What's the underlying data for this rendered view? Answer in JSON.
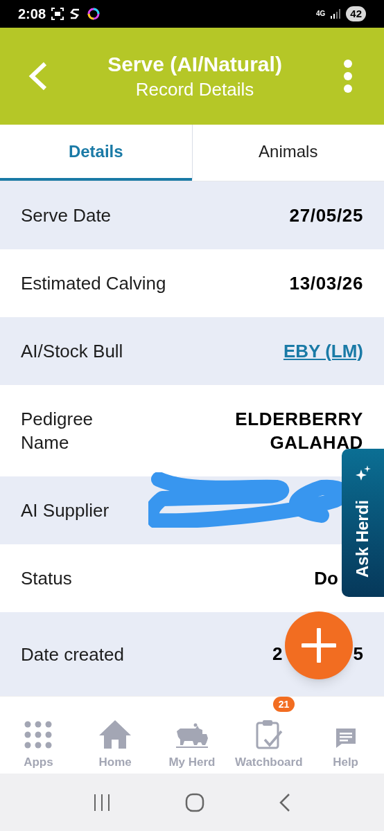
{
  "status_bar": {
    "time": "2:08",
    "network": "4G",
    "battery": "42"
  },
  "header": {
    "title": "Serve (AI/Natural)",
    "subtitle": "Record Details"
  },
  "tabs": [
    {
      "label": "Details",
      "selected": true
    },
    {
      "label": "Animals",
      "selected": false
    }
  ],
  "rows": [
    {
      "label": "Serve Date",
      "kind": "text",
      "value": "27/05/25",
      "redacted": false
    },
    {
      "label": "Estimated Calving",
      "kind": "text",
      "value": "13/03/26",
      "redacted": false
    },
    {
      "label": "AI/Stock Bull",
      "kind": "link",
      "value": "EBY (LM)",
      "redacted": false
    },
    {
      "label": "Pedigree Name",
      "kind": "text",
      "value": "ELDERBERRY GALAHAD",
      "redacted": false
    },
    {
      "label": "AI Supplier",
      "kind": "link",
      "redacted": true
    },
    {
      "label": "Status",
      "kind": "covered",
      "value": "Do",
      "redacted": false
    },
    {
      "label": "Date created",
      "kind": "split",
      "value_parts": [
        "2",
        "5"
      ],
      "redacted": false
    }
  ],
  "ask_tab": {
    "label": "Ask Herdi"
  },
  "nav": [
    {
      "label": "Apps",
      "kind": "apps"
    },
    {
      "label": "Home",
      "kind": "home"
    },
    {
      "label": "My Herd",
      "kind": "herd"
    },
    {
      "label": "Watchboard",
      "kind": "watch",
      "badge": "21"
    },
    {
      "label": "Help",
      "kind": "help"
    }
  ]
}
